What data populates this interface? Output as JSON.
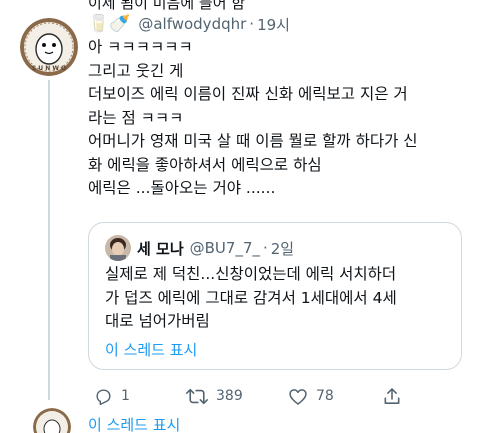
{
  "previous_tweet": {
    "cut_text": "이제 됨이 미음에 들어 함"
  },
  "tweet": {
    "name_emojis": "🥛🍼",
    "handle": "@alfwodydqhr",
    "separator": "·",
    "time": "19시",
    "body_lines": [
      "아 ㅋㅋㅋㅋㅋㅋ",
      "그리고 웃긴 게",
      "더보이즈 에릭 이름이 진짜 신화 에릭보고 지은 거",
      "라는 점 ㅋㅋㅋ",
      "어머니가 영재 미국 살 때 이름 뭘로 할까 하다가 신",
      "화 에릭을 좋아하셔서 에릭으로 하심",
      "에릭은 ...돌아오는 거야 ......"
    ]
  },
  "quote": {
    "name": "세 모나",
    "handle": "@BU7_7_",
    "separator": "·",
    "time": "2일",
    "body_lines": [
      "실제로 제 덕친...신창이었는데 에릭 서치하더",
      "가 덥즈 에릭에 그대로 감겨서 1세대에서 4세",
      "대로 넘어가버림"
    ],
    "show_thread": "이 스레드 표시"
  },
  "actions": {
    "reply": {
      "icon": "reply-icon",
      "count": "1"
    },
    "retweet": {
      "icon": "retweet-icon",
      "count": "389"
    },
    "like": {
      "icon": "heart-icon",
      "count": "78"
    },
    "share": {
      "icon": "share-icon"
    }
  },
  "footer": {
    "show_thread": "이 스레드 표시"
  },
  "colors": {
    "text": "#0f1419",
    "secondary": "#536471",
    "link": "#1d9bf0",
    "border": "#cfd9de",
    "avatar_ring": "#8b6a4a"
  }
}
